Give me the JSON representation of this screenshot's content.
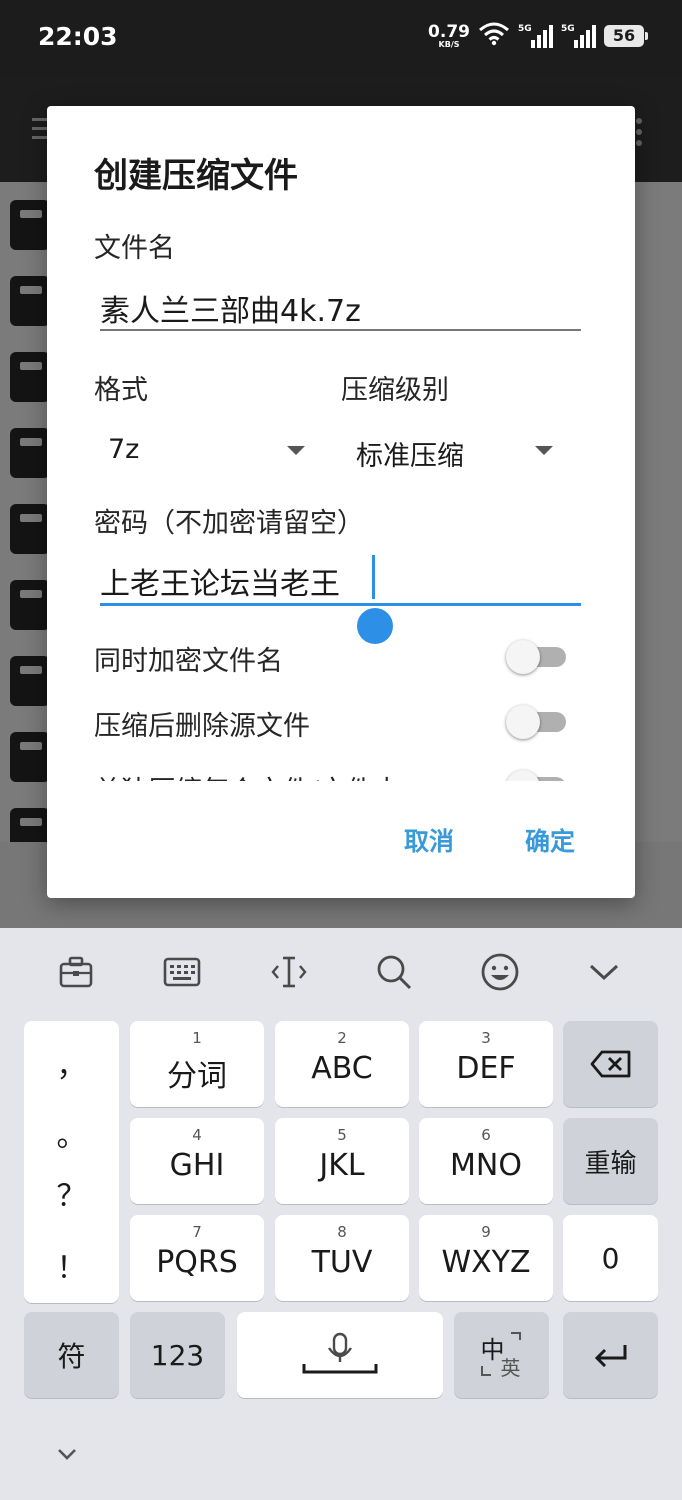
{
  "status_bar": {
    "time": "22:03",
    "net_speed_value": "0.79",
    "net_speed_unit": "KB/S",
    "sim1_label": "5G",
    "sim2_label": "5G",
    "battery": "56",
    "icons": [
      "wifi-icon",
      "signal-icon",
      "signal-icon",
      "battery-icon"
    ]
  },
  "dialog": {
    "title": "创建压缩文件",
    "filename_label": "文件名",
    "filename_value": "素人兰三部曲4k.7z",
    "format_label": "格式",
    "format_value": "7z",
    "level_label": "压缩级别",
    "level_value": "标准压缩",
    "password_label": "密码（不加密请留空）",
    "password_value": "上老王论坛当老王",
    "options": [
      {
        "label": "同时加密文件名",
        "on": false
      },
      {
        "label": "压缩后删除源文件",
        "on": false
      },
      {
        "label": "单独压缩每个文件/文件夹",
        "on": false
      }
    ],
    "cancel_label": "取消",
    "ok_label": "确定",
    "accent_color": "#2d8fe6"
  },
  "keyboard": {
    "toolbar_icons": [
      "toolbox-icon",
      "keyboard-icon",
      "text-cursor-icon",
      "search-icon",
      "emoji-icon",
      "collapse-chevron-icon"
    ],
    "punctuation": [
      "，",
      "。",
      "？",
      "！"
    ],
    "keys_row1": [
      {
        "num": "1",
        "label": "分词"
      },
      {
        "num": "2",
        "label": "ABC"
      },
      {
        "num": "3",
        "label": "DEF"
      }
    ],
    "keys_row2": [
      {
        "num": "4",
        "label": "GHI"
      },
      {
        "num": "5",
        "label": "JKL"
      },
      {
        "num": "6",
        "label": "MNO"
      }
    ],
    "keys_row3": [
      {
        "num": "7",
        "label": "PQRS"
      },
      {
        "num": "8",
        "label": "TUV"
      },
      {
        "num": "9",
        "label": "WXYZ"
      }
    ],
    "retype_label": "重输",
    "zero_label": "0",
    "symbols_label": "符",
    "numbers_label": "123",
    "lang_main": "中",
    "lang_sub": "英"
  }
}
